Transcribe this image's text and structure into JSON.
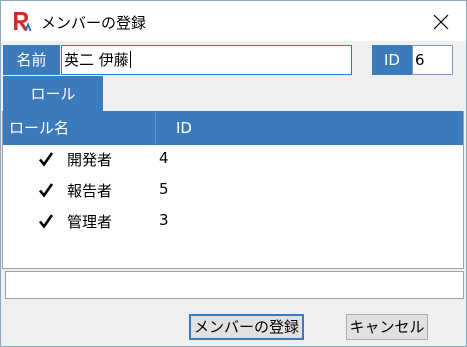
{
  "window": {
    "title": "メンバーの登録",
    "app_icon": "ra-logo-icon",
    "close_icon": "close-icon"
  },
  "form": {
    "name_label": "名前",
    "name_value": "英二 伊藤",
    "id_label": "ID",
    "id_value": "6"
  },
  "tabs": [
    {
      "label": "ロール",
      "selected": true
    }
  ],
  "roles_grid": {
    "columns": [
      "ロール名",
      "ID"
    ],
    "rows": [
      {
        "checked": true,
        "name": "開発者",
        "id": "4"
      },
      {
        "checked": true,
        "name": "報告者",
        "id": "5"
      },
      {
        "checked": true,
        "name": "管理者",
        "id": "3"
      }
    ]
  },
  "buttons": {
    "register_label": "メンバーの登録",
    "cancel_label": "キャンセル"
  },
  "colors": {
    "accent": "#3c7bbb",
    "input_border": "#7a9cc6",
    "logo_red": "#d42a2a",
    "logo_blue": "#2f63b8"
  }
}
